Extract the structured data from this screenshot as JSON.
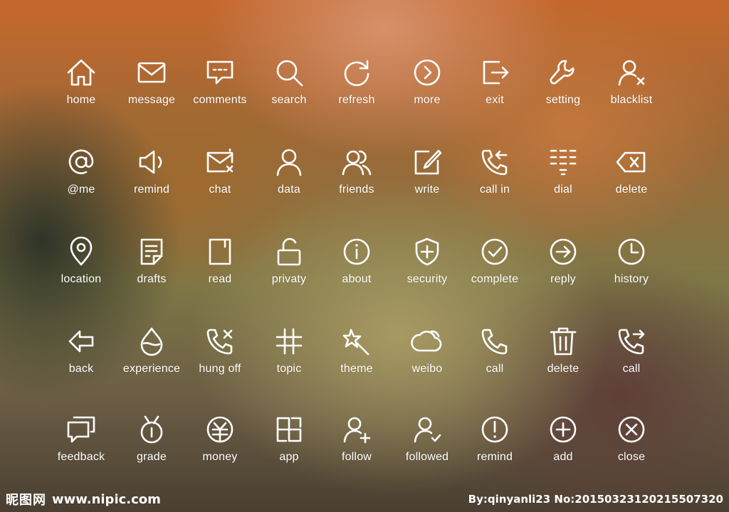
{
  "icons": [
    {
      "label": "home",
      "icon": "home-icon"
    },
    {
      "label": "message",
      "icon": "message-icon"
    },
    {
      "label": "comments",
      "icon": "comments-icon"
    },
    {
      "label": "search",
      "icon": "search-icon"
    },
    {
      "label": "refresh",
      "icon": "refresh-icon"
    },
    {
      "label": "more",
      "icon": "more-icon"
    },
    {
      "label": "exit",
      "icon": "exit-icon"
    },
    {
      "label": "setting",
      "icon": "setting-icon"
    },
    {
      "label": "blacklist",
      "icon": "blacklist-icon"
    },
    {
      "label": "@me",
      "icon": "at-me-icon"
    },
    {
      "label": "remind",
      "icon": "remind-speaker-icon"
    },
    {
      "label": "chat",
      "icon": "chat-icon"
    },
    {
      "label": "data",
      "icon": "data-user-icon"
    },
    {
      "label": "friends",
      "icon": "friends-icon"
    },
    {
      "label": "write",
      "icon": "write-icon"
    },
    {
      "label": "call in",
      "icon": "call-in-icon"
    },
    {
      "label": "dial",
      "icon": "dial-icon"
    },
    {
      "label": "delete",
      "icon": "delete-backspace-icon"
    },
    {
      "label": "location",
      "icon": "location-icon"
    },
    {
      "label": "drafts",
      "icon": "drafts-icon"
    },
    {
      "label": "read",
      "icon": "read-icon"
    },
    {
      "label": "privaty",
      "icon": "privacy-lock-icon"
    },
    {
      "label": "about",
      "icon": "about-icon"
    },
    {
      "label": "security",
      "icon": "security-shield-icon"
    },
    {
      "label": "complete",
      "icon": "complete-icon"
    },
    {
      "label": "reply",
      "icon": "reply-icon"
    },
    {
      "label": "history",
      "icon": "history-icon"
    },
    {
      "label": "back",
      "icon": "back-icon"
    },
    {
      "label": "experience",
      "icon": "experience-drop-icon"
    },
    {
      "label": "hung off",
      "icon": "hung-off-icon"
    },
    {
      "label": "topic",
      "icon": "topic-hash-icon"
    },
    {
      "label": "theme",
      "icon": "theme-wand-icon"
    },
    {
      "label": "weibo",
      "icon": "weibo-cloud-icon"
    },
    {
      "label": "call",
      "icon": "call-icon"
    },
    {
      "label": "delete",
      "icon": "delete-trash-icon"
    },
    {
      "label": "call",
      "icon": "call-out-icon"
    },
    {
      "label": "feedback",
      "icon": "feedback-icon"
    },
    {
      "label": "grade",
      "icon": "grade-medal-icon"
    },
    {
      "label": "money",
      "icon": "money-icon"
    },
    {
      "label": "app",
      "icon": "app-icon"
    },
    {
      "label": "follow",
      "icon": "follow-icon"
    },
    {
      "label": "followed",
      "icon": "followed-icon"
    },
    {
      "label": "remind",
      "icon": "remind-alert-icon"
    },
    {
      "label": "add",
      "icon": "add-icon"
    },
    {
      "label": "close",
      "icon": "close-icon"
    }
  ],
  "footer": {
    "logo_text": "昵图网",
    "site_url": "www.nipic.com",
    "credit": "By:qinyanli23 No:20150323120215507320"
  },
  "colors": {
    "icon_stroke": "#ffffff"
  }
}
